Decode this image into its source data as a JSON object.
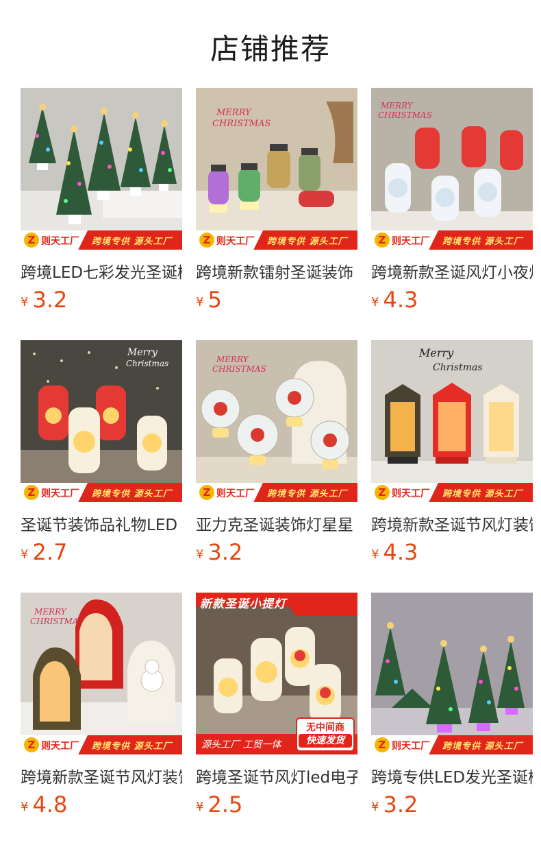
{
  "page": {
    "title": "店铺推荐"
  },
  "banner": {
    "brand_initial": "Z",
    "brand_name": "则天工厂",
    "slogan": "跨境专供  源头工厂"
  },
  "promo": {
    "top": "新款圣诞小提灯",
    "bottom": "源头工厂  工贸一体",
    "badge_line1": "无中间商",
    "badge_line2": "快速发货"
  },
  "products": [
    {
      "name": "跨境LED七彩发光圣诞树",
      "currency": "¥",
      "price": "3.2",
      "image": "mini-christmas-trees",
      "bg": "#c9c7c2"
    },
    {
      "name": "跨境新款镭射圣诞装饰",
      "currency": "¥",
      "price": "5",
      "image": "laser-lanterns",
      "bg": "#cfc3ad"
    },
    {
      "name": "跨境新款圣诞风灯小夜灯",
      "currency": "¥",
      "price": "4.3",
      "image": "santa-lanterns",
      "bg": "#b9b2a7"
    },
    {
      "name": "圣诞节装饰品礼物LED",
      "currency": "¥",
      "price": "2.7",
      "image": "red-white-lanterns",
      "bg": "#4a4640"
    },
    {
      "name": "亚力克圣诞装饰灯星星",
      "currency": "¥",
      "price": "3.2",
      "image": "acrylic-globe-lights",
      "bg": "#c8bfae"
    },
    {
      "name": "跨境新款圣诞节风灯装饰",
      "currency": "¥",
      "price": "4.3",
      "image": "hexagon-lanterns",
      "bg": "#d4d0ca"
    },
    {
      "name": "跨境新款圣诞节风灯装饰",
      "currency": "¥",
      "price": "4.8",
      "image": "arched-lanterns",
      "bg": "#d7d3cc"
    },
    {
      "name": "跨境圣诞节风灯led电子",
      "currency": "¥",
      "price": "2.5",
      "image": "mini-lanterns-promo",
      "bg": "#6b5d4f"
    },
    {
      "name": "跨境专供LED发光圣诞树",
      "currency": "¥",
      "price": "3.2",
      "image": "christmas-trees-purple",
      "bg": "#a49fa6"
    }
  ]
}
